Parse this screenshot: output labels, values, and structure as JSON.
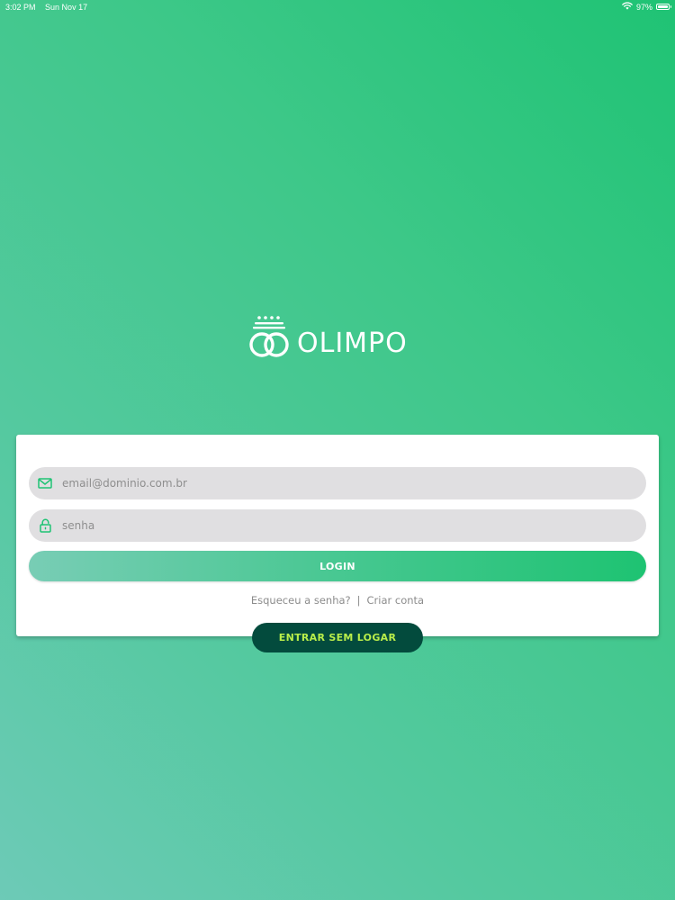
{
  "status_bar": {
    "time": "3:02 PM",
    "date": "Sun Nov 17",
    "battery": "97%",
    "battery_level": 0.97
  },
  "logo": {
    "text": "OLIMPO"
  },
  "login_form": {
    "email_placeholder": "email@dominio.com.br",
    "password_placeholder": "senha",
    "login_label": "LOGIN",
    "forgot_password": "Esqueceu a senha?",
    "separator": "|",
    "create_account": "Criar conta"
  },
  "guest": {
    "label": "ENTRAR SEM LOGAR"
  },
  "colors": {
    "brand_green": "#1fc374",
    "dark_green": "#034b3d",
    "lime": "#b9ee4a",
    "field_bg": "#e0dfe1"
  },
  "icons": {
    "email": "envelope-icon",
    "password": "lock-icon",
    "wifi": "wifi-icon",
    "battery": "battery-icon"
  }
}
